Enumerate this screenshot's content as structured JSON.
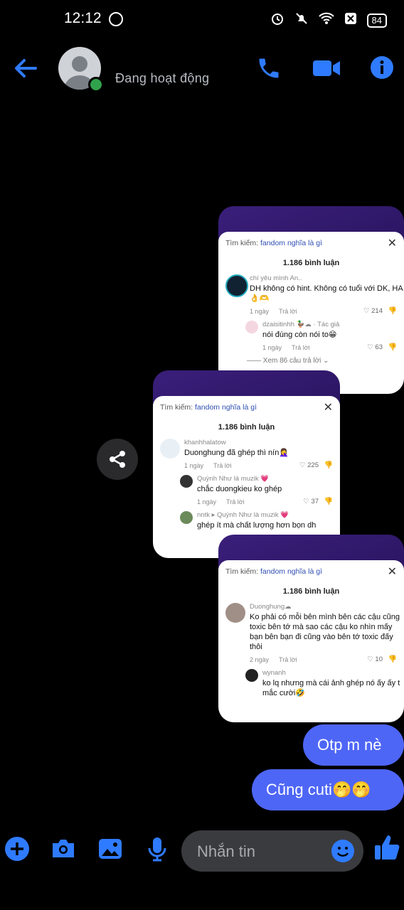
{
  "status_bar": {
    "time": "12:12",
    "battery": "84"
  },
  "header": {
    "presence": "Đang hoạt động"
  },
  "shots": [
    {
      "search_label": "Tìm kiếm:",
      "search_query": "fandom nghĩa là gì",
      "count": "1.186 bình luận",
      "comments": [
        {
          "who": "chí yêu mình An..",
          "text": "DH không có hint. Không có tuổi với DK, HA👌🫶",
          "time": "1 ngày",
          "reply": "Trả lời",
          "likes": "214"
        },
        {
          "who": "dzaisitinhh 🦆☁ · Tác giả",
          "text": "nói đúng còn nói to😁",
          "time": "1 ngày",
          "reply": "Trả lời",
          "likes": "63"
        }
      ],
      "more": "Xem 86 câu trả lời"
    },
    {
      "search_label": "Tìm kiếm:",
      "search_query": "fandom nghĩa là gì",
      "count": "1.186 bình luận",
      "comments": [
        {
          "who": "khanhhalatow",
          "text": "Duonghung đã ghép thì nín🤦‍♀️",
          "time": "1 ngày",
          "reply": "Trả lời",
          "likes": "225"
        },
        {
          "who": "Quỳnh Như là muzik 💗",
          "text": "chắc duongkieu ko ghép",
          "time": "1 ngày",
          "reply": "Trả lời",
          "likes": "37"
        },
        {
          "who": "nntk ▸ Quỳnh Như là muzik 💗",
          "text": "ghép ít mà chất lượng hơn bọn dh",
          "time": "",
          "reply": "",
          "likes": ""
        }
      ]
    },
    {
      "search_label": "Tìm kiếm:",
      "search_query": "fandom nghĩa là gì",
      "count": "1.186 bình luận",
      "comments": [
        {
          "who": "Duonghung☁",
          "text": "Ko phải có mỗi bên mình bên các cậu cũng toxic bên tớ mà sao các cậu ko nhìn mấy bạn bên bạn đi cũng vào bên tớ toxic đấy thôi",
          "time": "2 ngày",
          "reply": "Trả lời",
          "likes": "10"
        },
        {
          "who": "wynanh",
          "text": "ko lq nhưng mà cái ảnh ghép nó ấy ấy t mắc cười🤣",
          "time": "",
          "reply": "",
          "likes": ""
        }
      ]
    }
  ],
  "messages": [
    {
      "text": "Otp m nè"
    },
    {
      "text": "Cũng cuti🤭🤭"
    }
  ],
  "composer": {
    "placeholder": "Nhắn tin"
  },
  "colors": {
    "accent": "#4e66f6",
    "icon_blue": "#2f7bff",
    "online": "#31a24c"
  }
}
